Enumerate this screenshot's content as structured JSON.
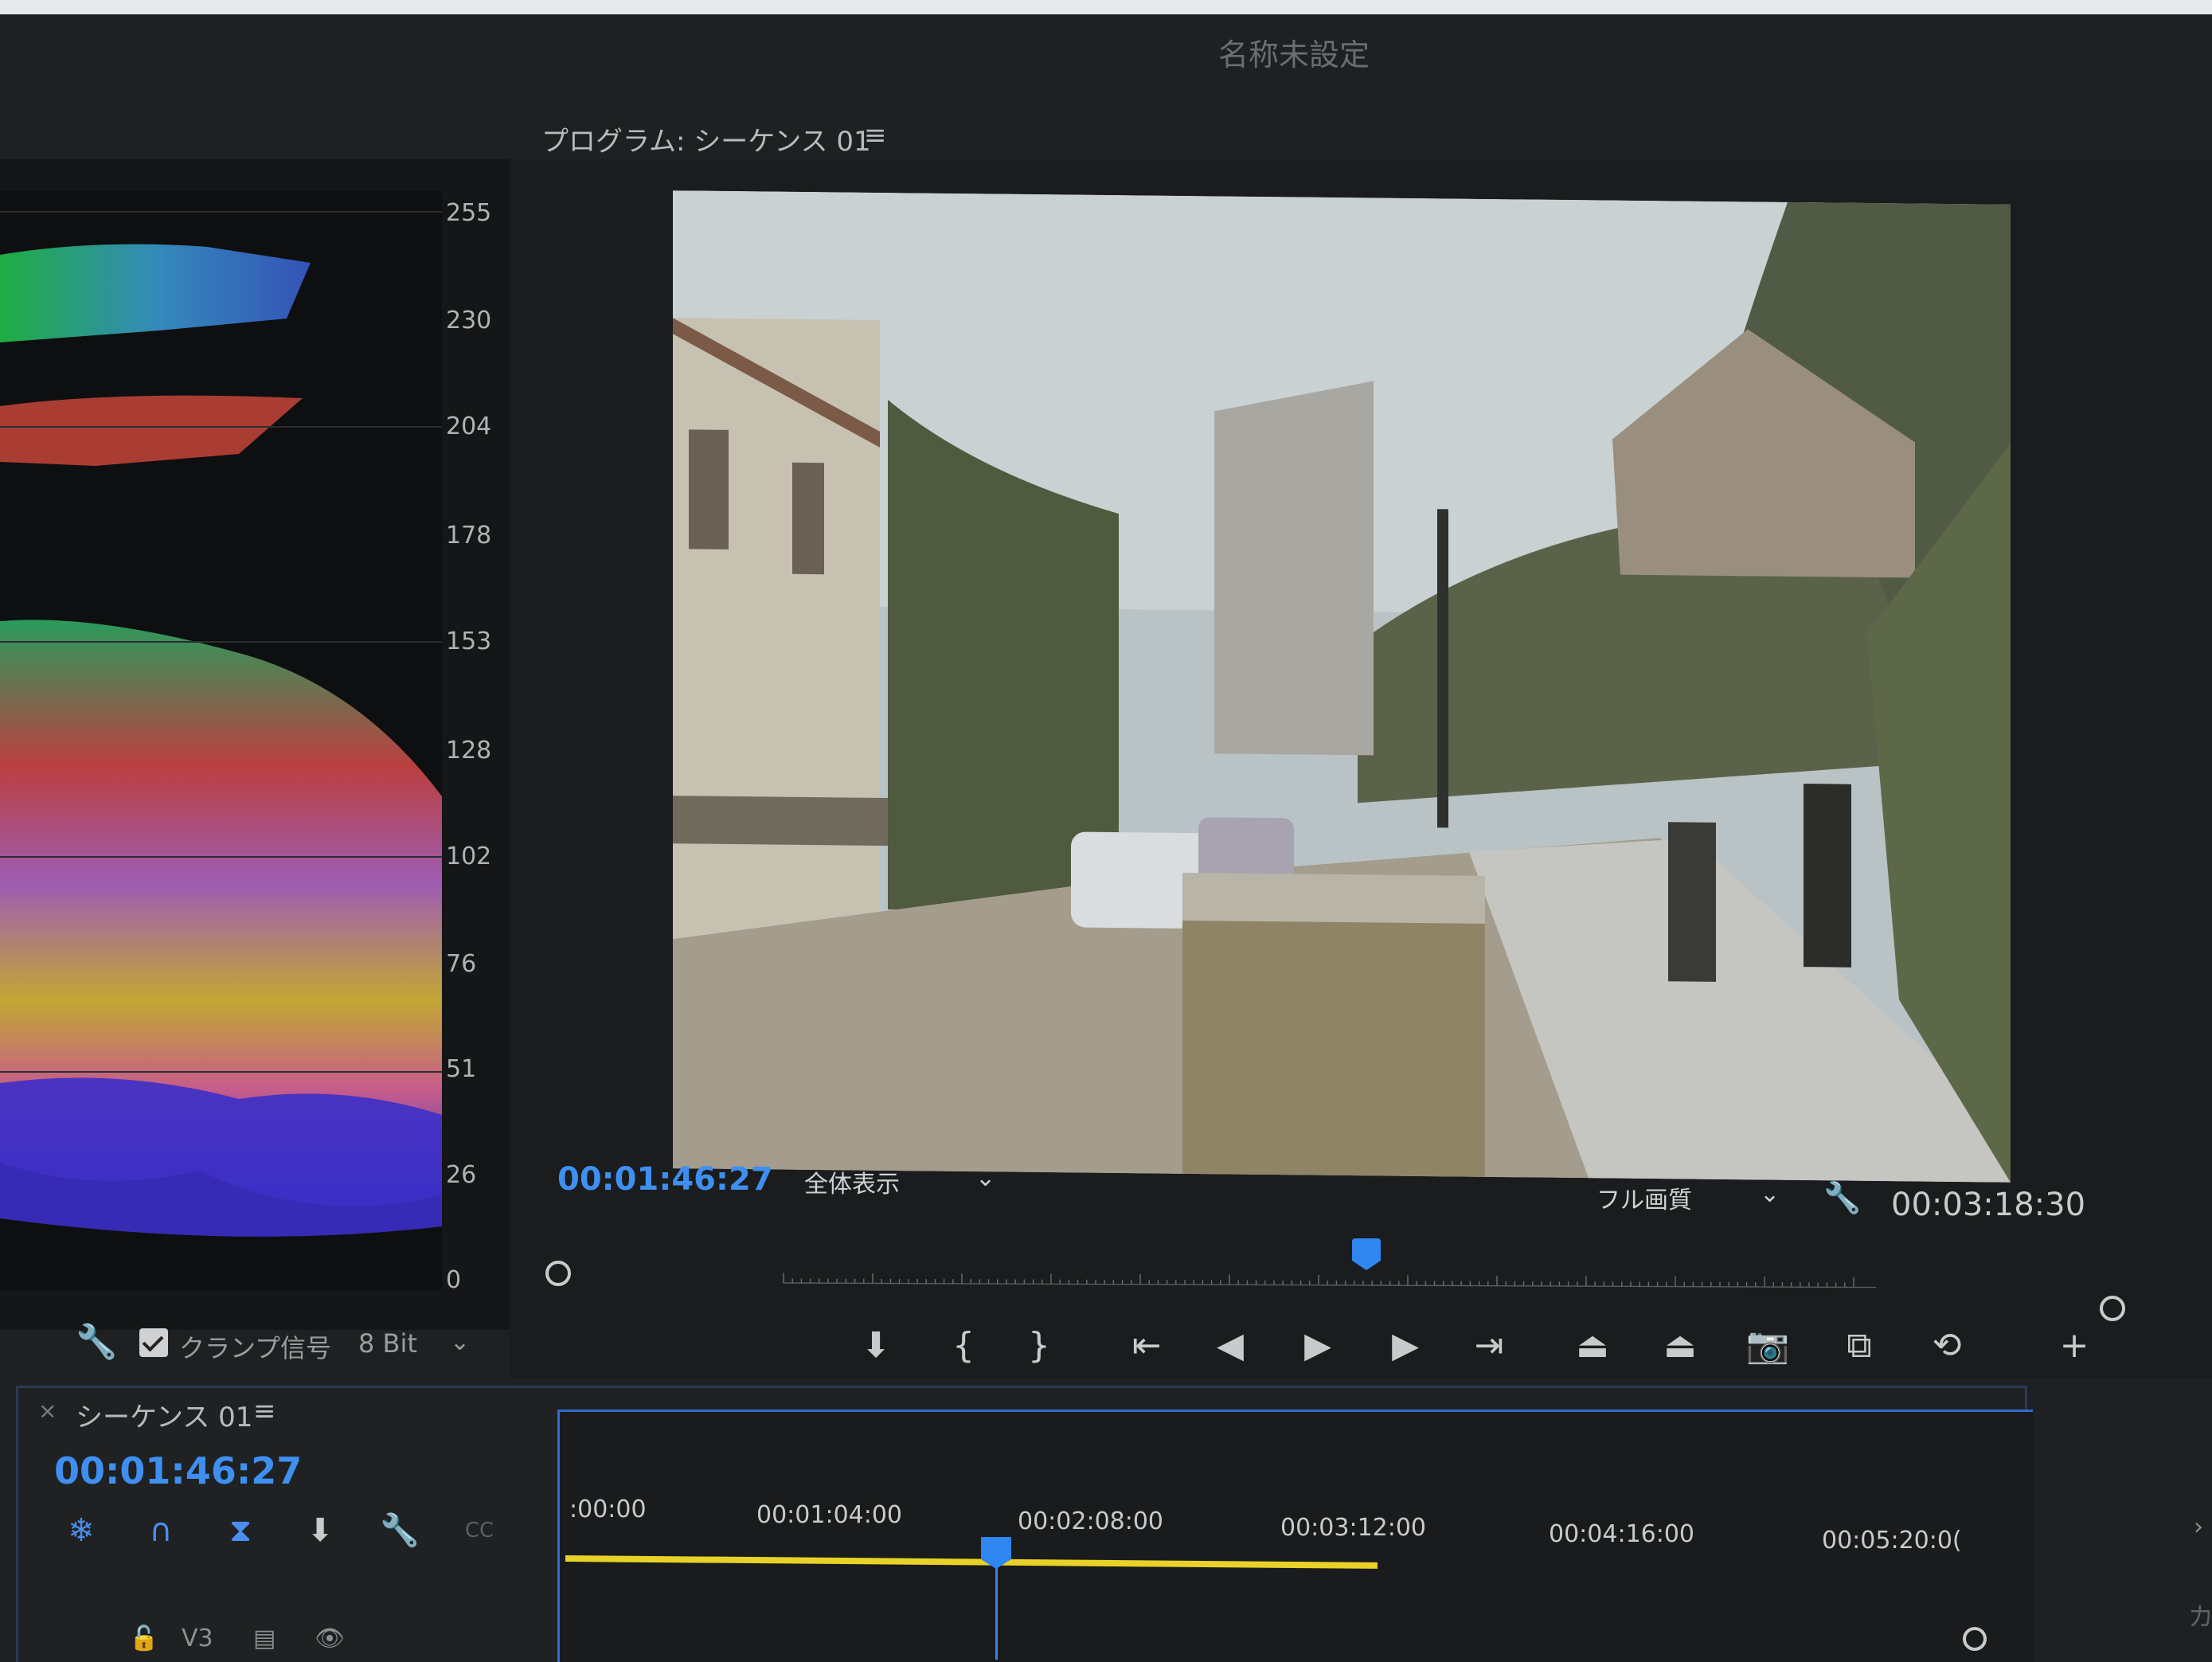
{
  "window": {
    "title": "名称未設定"
  },
  "scopes": {
    "scale": [
      "255",
      "230",
      "204",
      "178",
      "153",
      "128",
      "102",
      "76",
      "51",
      "26",
      "0"
    ],
    "clamp_label": "クランプ信号",
    "clamp_checked": true,
    "bit_depth": "8 Bit",
    "icons": [
      "wrench-icon",
      "checkbox-icon",
      "chevron-down-icon"
    ]
  },
  "program": {
    "header": "プログラム: シーケンス 01",
    "menu_glyph": "≡",
    "current_timecode": "00:01:46:27",
    "fit": "全体表示",
    "quality": "フル画質",
    "duration_timecode": "00:03:18:30",
    "playhead_fraction": 0.53
  },
  "transport": {
    "buttons": [
      "marker",
      "mark-in",
      "mark-out",
      "go-to-in",
      "step-back",
      "play",
      "step-forward",
      "go-to-out",
      "lift",
      "extract",
      "export-frame",
      "comparison-view",
      "toggle-proxies",
      "add-button"
    ]
  },
  "timeline": {
    "close_glyph": "×",
    "sequence_name": "シーケンス 01",
    "menu_glyph": "≡",
    "current_timecode": "00:01:46:27",
    "ruler": [
      ":00:00",
      "00:01:04:00",
      "00:02:08:00",
      "00:03:12:00",
      "00:04:16:00",
      "00:05:20:0("
    ],
    "track": "V3",
    "cc_label": "CC",
    "work_area_fraction": 0.54,
    "playhead_fraction": 0.32
  },
  "colors": {
    "accent_blue": "#3e8ff0",
    "work_area_yellow": "#e8d228",
    "panel_bg": "#1e2021"
  }
}
